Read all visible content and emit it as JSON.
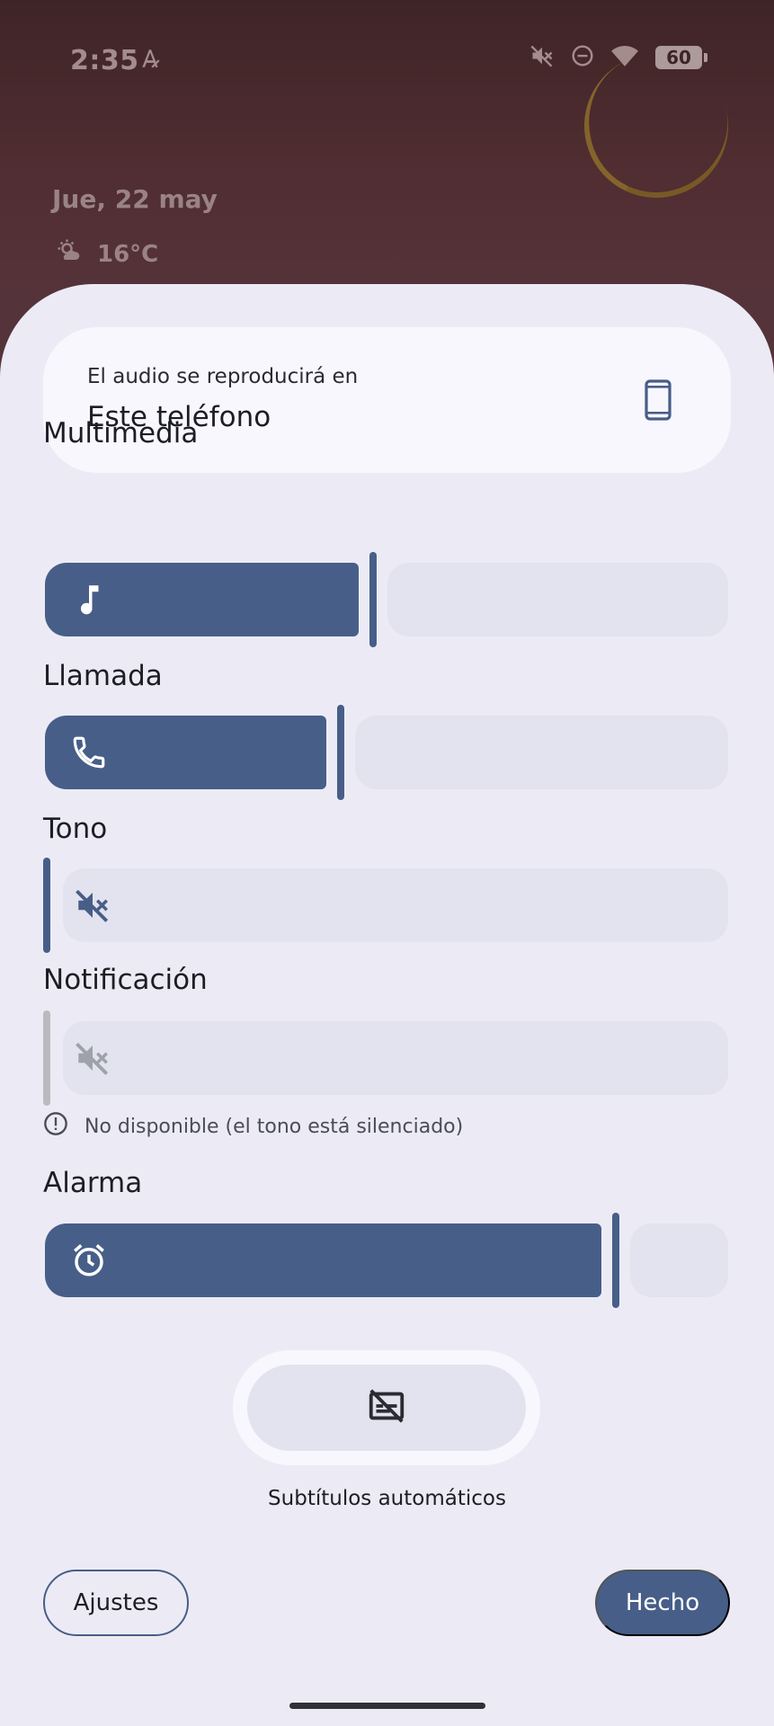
{
  "status_bar": {
    "time": "2:35",
    "battery": "60",
    "icons": [
      "font-a-icon",
      "mute-icon",
      "dnd-icon",
      "wifi-icon",
      "battery-icon"
    ]
  },
  "lockscreen": {
    "date": "Jue, 22 may",
    "temperature": "16°C",
    "weather_icon": "partly-cloudy-icon"
  },
  "output": {
    "subtitle": "El audio se reproducirá en",
    "device": "Este teléfono",
    "icon": "smartphone-icon"
  },
  "volumes": {
    "media": {
      "label": "Multimedia",
      "level": 0.48,
      "icon": "music-note-icon"
    },
    "call": {
      "label": "Llamada",
      "level": 0.43,
      "icon": "phone-icon"
    },
    "ring": {
      "label": "Tono",
      "level": 0.0,
      "icon": "volume-off-icon"
    },
    "notification": {
      "label": "Notificación",
      "level": 0.0,
      "icon": "volume-off-icon",
      "disabled": true,
      "info": "No disponible (el tono está silenciado)"
    },
    "alarm": {
      "label": "Alarma",
      "level": 0.85,
      "icon": "alarm-icon"
    }
  },
  "captions": {
    "label": "Subtítulos automáticos",
    "icon": "captions-off-icon"
  },
  "buttons": {
    "settings": "Ajustes",
    "done": "Hecho"
  },
  "colors": {
    "accent": "#475e88",
    "sheet": "#ecebf5",
    "track": "#e2e3ee",
    "card": "#f8f7fd"
  }
}
